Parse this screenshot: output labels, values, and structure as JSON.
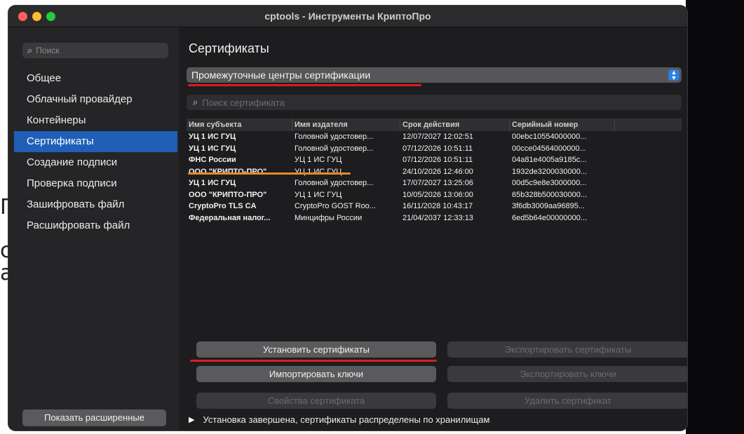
{
  "window": {
    "title": "cptools - Инструменты КриптоПро"
  },
  "background": {
    "glyphs": [
      "Г",
      "с",
      "а"
    ]
  },
  "sidebar": {
    "search_placeholder": "Поиск",
    "items": [
      {
        "label": "Общее"
      },
      {
        "label": "Облачный провайдер"
      },
      {
        "label": "Контейнеры"
      },
      {
        "label": "Сертификаты",
        "active": true
      },
      {
        "label": "Создание подписи"
      },
      {
        "label": "Проверка подписи"
      },
      {
        "label": "Зашифровать файл"
      },
      {
        "label": "Расшифровать файл"
      }
    ],
    "show_advanced_label": "Показать расширенные"
  },
  "main": {
    "section_title": "Сертификаты",
    "store_dropdown": {
      "selected": "Промежуточные центры сертификации"
    },
    "cert_search_placeholder": "Поиск сертификата",
    "table": {
      "columns": [
        "Имя субъекта",
        "Имя издателя",
        "Срок действия",
        "Серийный номер",
        ""
      ],
      "rows": [
        [
          "УЦ 1 ИС ГУЦ",
          "Головной удостовер...",
          "12/07/2027 12:02:51",
          "00ebc10554000000..."
        ],
        [
          "УЦ 1 ИС ГУЦ",
          "Головной удостовер...",
          "07/12/2026 10:51:11",
          "00cce04564000000..."
        ],
        [
          "ФНС России",
          "УЦ 1 ИС ГУЦ",
          "07/12/2026 10:51:11",
          "04a81e4005a9185c..."
        ],
        [
          "ООО \"КРИПТО-ПРО\"",
          "УЦ 1 ИС ГУЦ",
          "24/10/2026 12:46:00",
          "1932de3200030000..."
        ],
        [
          "УЦ 1 ИС ГУЦ",
          "Головной удостовер...",
          "17/07/2027 13:25:06",
          "00d5c9e8e3000000..."
        ],
        [
          "ООО \"КРИПТО-ПРО\"",
          "УЦ 1 ИС ГУЦ",
          "10/05/2026 13:06:00",
          "65b328b500030000..."
        ],
        [
          "CryptoPro TLS CA",
          "CryptoPro GOST Roo...",
          "16/11/2028 10:43:17",
          "3f6db3009aa96895..."
        ],
        [
          "Федеральная налог...",
          "Минцифры России",
          "21/04/2037 12:33:13",
          "6ed5b64e00000000..."
        ]
      ]
    },
    "buttons": {
      "install_certs": "Установить сертификаты",
      "export_certs": "Экспортировать сертификаты",
      "import_keys": "Импортировать ключи",
      "export_keys": "Экспортировать ключи",
      "cert_properties": "Свойства сертификата",
      "delete_cert": "Удалить сертификат"
    },
    "status_text": "Установка завершена, сертификаты распределены по хранилищам"
  },
  "colors": {
    "accent": "#1f5fb8",
    "annotation_red": "#e11a1a",
    "annotation_orange": "#e8892a"
  }
}
